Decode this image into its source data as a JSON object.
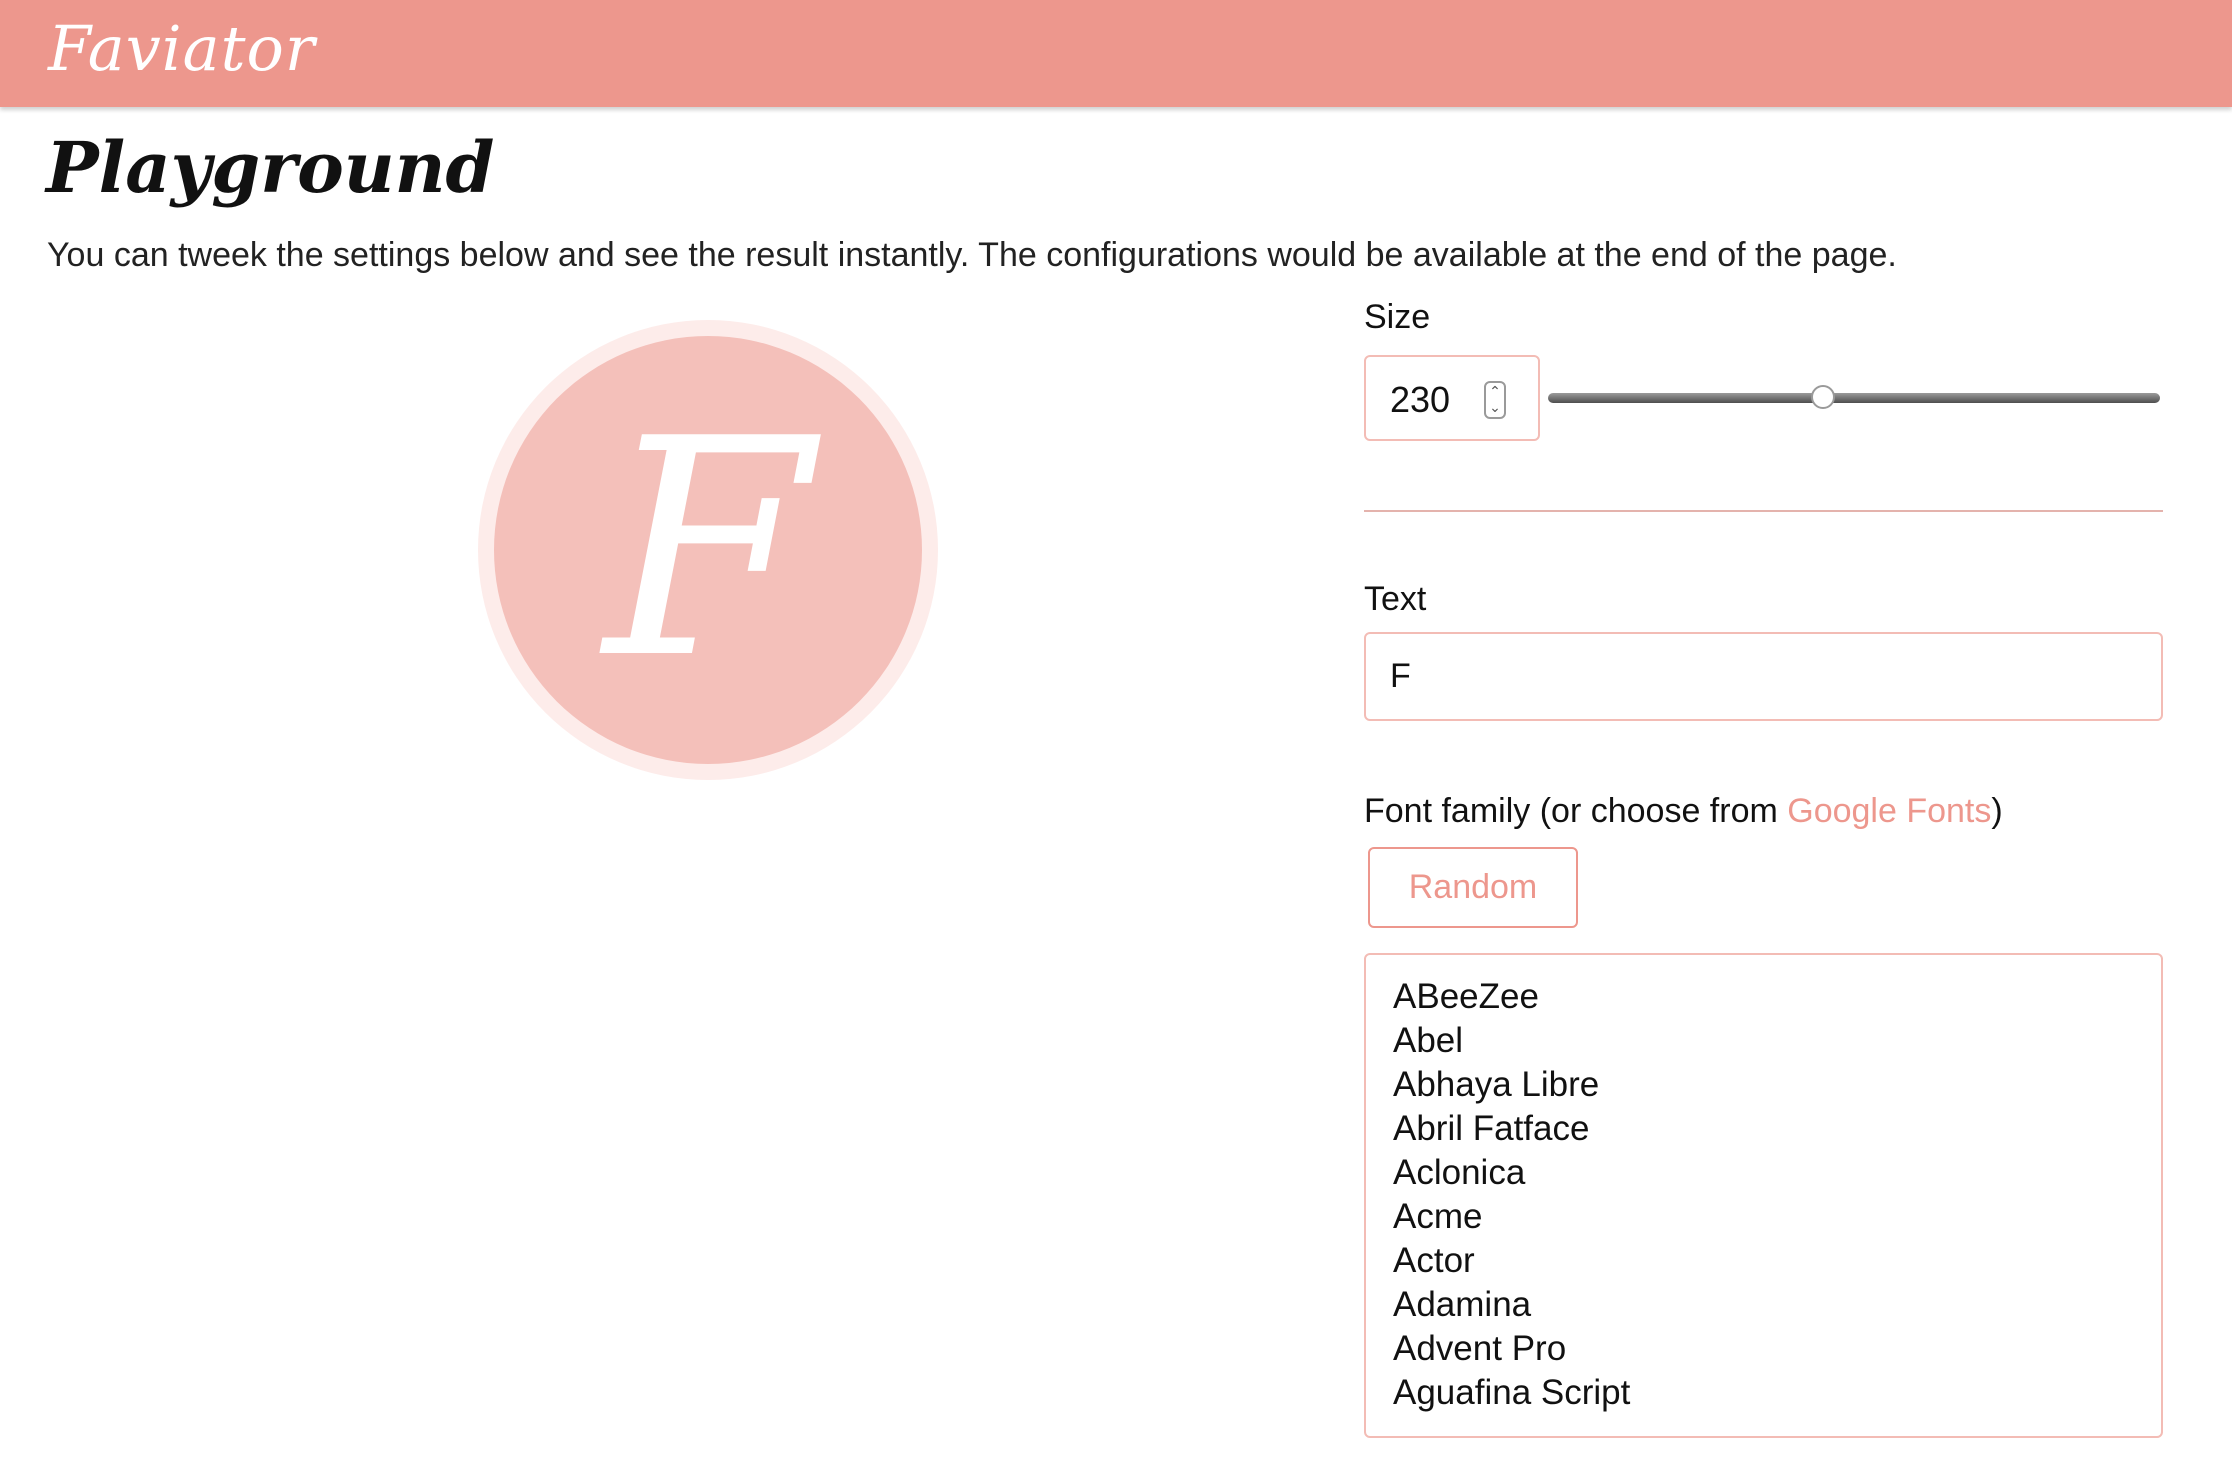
{
  "header": {
    "brand": "Faviator"
  },
  "page": {
    "title": "Playground",
    "intro": "You can tweek the settings below and see the result instantly. The configurations would be available at the end of the page."
  },
  "preview": {
    "text": "F",
    "outer_color": "#fdecea",
    "inner_color": "#f4c0ba",
    "text_color": "#ffffff"
  },
  "controls": {
    "size": {
      "label": "Size",
      "value": "230",
      "slider_fraction": 0.45
    },
    "text": {
      "label": "Text",
      "value": "F"
    },
    "font_family": {
      "label_prefix": "Font family (or choose from ",
      "link_text": "Google Fonts",
      "label_suffix": ")",
      "random_label": "Random",
      "options": [
        "ABeeZee",
        "Abel",
        "Abhaya Libre",
        "Abril Fatface",
        "Aclonica",
        "Acme",
        "Actor",
        "Adamina",
        "Advent Pro",
        "Aguafina Script"
      ]
    }
  },
  "colors": {
    "accent": "#ed978d",
    "border": "#f3bcb5"
  }
}
